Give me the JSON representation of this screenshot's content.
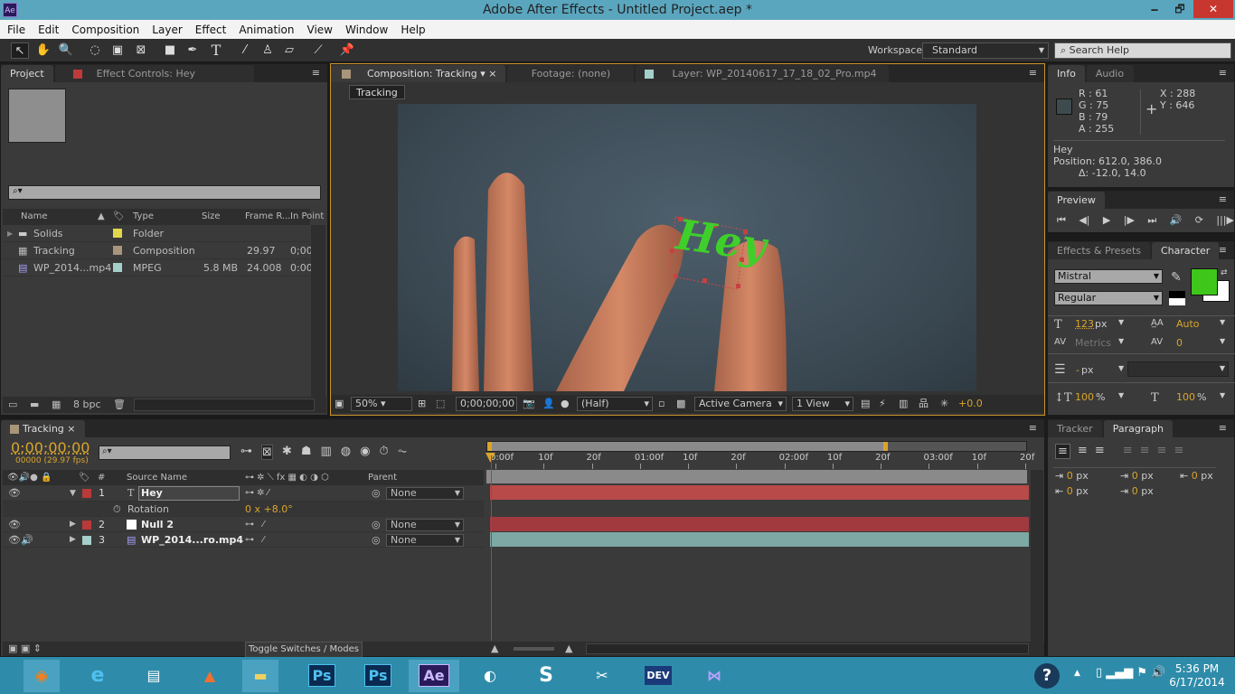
{
  "window": {
    "title": "Adobe After Effects - Untitled Project.aep *",
    "logo": "Ae",
    "minimize": "🗕",
    "restore": "🗗",
    "close": "✕"
  },
  "menu": [
    "File",
    "Edit",
    "Composition",
    "Layer",
    "Effect",
    "Animation",
    "View",
    "Window",
    "Help"
  ],
  "toolbar": {
    "tools": [
      "selection-tool",
      "hand-tool",
      "zoom-tool",
      "rotation-tool",
      "camera-tool",
      "pan-behind-tool",
      "shape-tool",
      "pen-tool",
      "type-tool",
      "brush-tool",
      "clone-stamp-tool",
      "eraser-tool",
      "roto-brush-tool",
      "puppet-pin-tool"
    ],
    "workspace_label": "Workspace:",
    "workspace_value": "Standard",
    "search_placeholder": "Search Help"
  },
  "project_panel": {
    "tabs": [
      "Project",
      "Effect Controls: Hey"
    ],
    "columns": [
      "Name",
      "Type",
      "Size",
      "Frame R...",
      "In Point"
    ],
    "items": [
      {
        "name": "Solids",
        "label_color": "#e0d84a",
        "type": "Folder",
        "size": "",
        "frame_rate": "",
        "in_point": "",
        "icon": "folder-icon"
      },
      {
        "name": "Tracking",
        "label_color": "#a8957a",
        "type": "Composition",
        "size": "",
        "frame_rate": "29.97",
        "in_point": "0;00",
        "icon": "composition-icon"
      },
      {
        "name": "WP_2014...mp4",
        "label_color": "#a4cfca",
        "type": "MPEG",
        "size": "5.8 MB",
        "frame_rate": "24.008",
        "in_point": "0:00",
        "icon": "video-file-icon"
      }
    ],
    "bpc": "8 bpc"
  },
  "comp_panel": {
    "tabs": [
      "Composition: Tracking",
      "Footage: (none)",
      "Layer: WP_20140617_17_18_02_Pro.mp4"
    ],
    "breadcrumb": "Tracking",
    "overlay_text": "Hey",
    "text_color": "#3fcf2a",
    "footer": {
      "zoom": "50%",
      "timecode": "0;00;00;00",
      "resolution": "(Half)",
      "camera": "Active Camera",
      "views": "1 View",
      "exposure": "+0.0"
    }
  },
  "info_panel": {
    "tabs": [
      "Info",
      "Audio"
    ],
    "r": "R : 61",
    "g": "G : 75",
    "b": "B : 79",
    "a": "A :  255",
    "x": "X : 288",
    "y": "Y : 646",
    "swatch": "#3d4b4f",
    "layer": "Hey",
    "position": "Position: 612.0, 386.0",
    "delta": "Δ: -12.0, 14.0"
  },
  "preview_panel": {
    "tabs": [
      "Preview"
    ],
    "buttons": [
      "⏮",
      "◀|",
      "▶",
      "|▶",
      "⏭",
      "🔊",
      "⟳",
      "|||▶"
    ]
  },
  "character_panel": {
    "tabs": [
      "Effects & Presets",
      "Character"
    ],
    "font": "Mistral",
    "style": "Regular",
    "fill_color": "#3ec71a",
    "size": "123",
    "size_unit": "px",
    "leading": "Auto",
    "kerning": "Metrics",
    "tracking": "0",
    "stroke": "-",
    "stroke_unit": "px",
    "vscale": "100",
    "hscale": "100",
    "pct": "%"
  },
  "paragraph_panel": {
    "tabs": [
      "Tracker",
      "Paragraph"
    ],
    "indent_values": [
      "0",
      "0",
      "0",
      "0",
      "0"
    ],
    "unit": "px"
  },
  "timeline": {
    "tab": "Tracking",
    "timecode": "0;00;00;00",
    "frame_info": "00000 (29.97 fps)",
    "columns": {
      "number": "#",
      "source": "Source Name",
      "parent": "Parent"
    },
    "ruler": [
      "0:00f",
      "10f",
      "20f",
      "01:00f",
      "10f",
      "20f",
      "02:00f",
      "10f",
      "20f",
      "03:00f",
      "10f",
      "20f"
    ],
    "layers": [
      {
        "num": "1",
        "name": "Hey",
        "label": "#b83a3a",
        "icon": "T",
        "parent": "None",
        "bar": "#b84a4a"
      },
      {
        "num": "2",
        "name": "Null 2",
        "label": "#b83a3a",
        "icon": "",
        "parent": "None",
        "bar": "#a03a3e"
      },
      {
        "num": "3",
        "name": "WP_2014...ro.mp4",
        "label": "#a4cfca",
        "icon": "",
        "parent": "None",
        "bar": "#7ea8a4"
      }
    ],
    "property": {
      "name": "Rotation",
      "value_rev": "0",
      "value_x": "x",
      "value_deg": "+8.0°"
    },
    "toggle": "Toggle Switches / Modes"
  },
  "taskbar": {
    "apps": [
      "Firefox",
      "Internet Explorer",
      "Task Manager",
      "MATLAB",
      "File Explorer",
      "Ps",
      "Ps",
      "Ae",
      "Media",
      "Skype",
      "Snipping",
      "DEV",
      "Visual Studio"
    ],
    "time": "5:36 PM",
    "date": "6/17/2014",
    "help": "?"
  }
}
